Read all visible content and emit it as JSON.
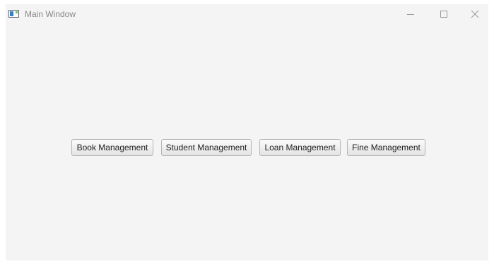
{
  "window": {
    "title": "Main Window",
    "icon": "app-window-icon",
    "controls": {
      "minimize": "minimize-icon",
      "maximize": "maximize-icon",
      "close": "close-icon"
    }
  },
  "main": {
    "buttons": [
      {
        "label": "Book Management"
      },
      {
        "label": "Student Management"
      },
      {
        "label": "Loan Management"
      },
      {
        "label": "Fine Management"
      }
    ]
  },
  "colors": {
    "window_background": "#f4f4f4",
    "title_text": "#888888",
    "button_border": "#b5b5b5",
    "button_text": "#222222"
  }
}
